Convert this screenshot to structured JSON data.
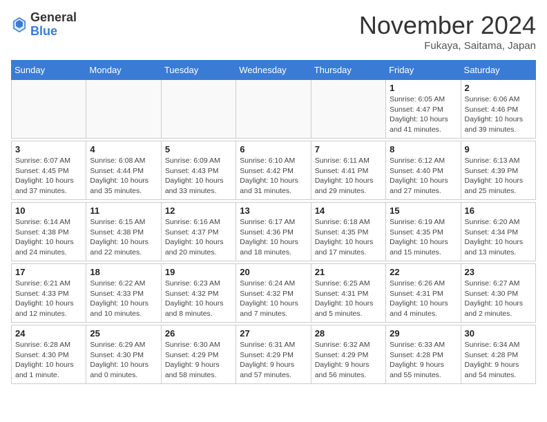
{
  "logo": {
    "general": "General",
    "blue": "Blue"
  },
  "header": {
    "month": "November 2024",
    "location": "Fukaya, Saitama, Japan"
  },
  "weekdays": [
    "Sunday",
    "Monday",
    "Tuesday",
    "Wednesday",
    "Thursday",
    "Friday",
    "Saturday"
  ],
  "weeks": [
    [
      {
        "day": "",
        "info": ""
      },
      {
        "day": "",
        "info": ""
      },
      {
        "day": "",
        "info": ""
      },
      {
        "day": "",
        "info": ""
      },
      {
        "day": "",
        "info": ""
      },
      {
        "day": "1",
        "info": "Sunrise: 6:05 AM\nSunset: 4:47 PM\nDaylight: 10 hours and 41 minutes."
      },
      {
        "day": "2",
        "info": "Sunrise: 6:06 AM\nSunset: 4:46 PM\nDaylight: 10 hours and 39 minutes."
      }
    ],
    [
      {
        "day": "3",
        "info": "Sunrise: 6:07 AM\nSunset: 4:45 PM\nDaylight: 10 hours and 37 minutes."
      },
      {
        "day": "4",
        "info": "Sunrise: 6:08 AM\nSunset: 4:44 PM\nDaylight: 10 hours and 35 minutes."
      },
      {
        "day": "5",
        "info": "Sunrise: 6:09 AM\nSunset: 4:43 PM\nDaylight: 10 hours and 33 minutes."
      },
      {
        "day": "6",
        "info": "Sunrise: 6:10 AM\nSunset: 4:42 PM\nDaylight: 10 hours and 31 minutes."
      },
      {
        "day": "7",
        "info": "Sunrise: 6:11 AM\nSunset: 4:41 PM\nDaylight: 10 hours and 29 minutes."
      },
      {
        "day": "8",
        "info": "Sunrise: 6:12 AM\nSunset: 4:40 PM\nDaylight: 10 hours and 27 minutes."
      },
      {
        "day": "9",
        "info": "Sunrise: 6:13 AM\nSunset: 4:39 PM\nDaylight: 10 hours and 25 minutes."
      }
    ],
    [
      {
        "day": "10",
        "info": "Sunrise: 6:14 AM\nSunset: 4:38 PM\nDaylight: 10 hours and 24 minutes."
      },
      {
        "day": "11",
        "info": "Sunrise: 6:15 AM\nSunset: 4:38 PM\nDaylight: 10 hours and 22 minutes."
      },
      {
        "day": "12",
        "info": "Sunrise: 6:16 AM\nSunset: 4:37 PM\nDaylight: 10 hours and 20 minutes."
      },
      {
        "day": "13",
        "info": "Sunrise: 6:17 AM\nSunset: 4:36 PM\nDaylight: 10 hours and 18 minutes."
      },
      {
        "day": "14",
        "info": "Sunrise: 6:18 AM\nSunset: 4:35 PM\nDaylight: 10 hours and 17 minutes."
      },
      {
        "day": "15",
        "info": "Sunrise: 6:19 AM\nSunset: 4:35 PM\nDaylight: 10 hours and 15 minutes."
      },
      {
        "day": "16",
        "info": "Sunrise: 6:20 AM\nSunset: 4:34 PM\nDaylight: 10 hours and 13 minutes."
      }
    ],
    [
      {
        "day": "17",
        "info": "Sunrise: 6:21 AM\nSunset: 4:33 PM\nDaylight: 10 hours and 12 minutes."
      },
      {
        "day": "18",
        "info": "Sunrise: 6:22 AM\nSunset: 4:33 PM\nDaylight: 10 hours and 10 minutes."
      },
      {
        "day": "19",
        "info": "Sunrise: 6:23 AM\nSunset: 4:32 PM\nDaylight: 10 hours and 8 minutes."
      },
      {
        "day": "20",
        "info": "Sunrise: 6:24 AM\nSunset: 4:32 PM\nDaylight: 10 hours and 7 minutes."
      },
      {
        "day": "21",
        "info": "Sunrise: 6:25 AM\nSunset: 4:31 PM\nDaylight: 10 hours and 5 minutes."
      },
      {
        "day": "22",
        "info": "Sunrise: 6:26 AM\nSunset: 4:31 PM\nDaylight: 10 hours and 4 minutes."
      },
      {
        "day": "23",
        "info": "Sunrise: 6:27 AM\nSunset: 4:30 PM\nDaylight: 10 hours and 2 minutes."
      }
    ],
    [
      {
        "day": "24",
        "info": "Sunrise: 6:28 AM\nSunset: 4:30 PM\nDaylight: 10 hours and 1 minute."
      },
      {
        "day": "25",
        "info": "Sunrise: 6:29 AM\nSunset: 4:30 PM\nDaylight: 10 hours and 0 minutes."
      },
      {
        "day": "26",
        "info": "Sunrise: 6:30 AM\nSunset: 4:29 PM\nDaylight: 9 hours and 58 minutes."
      },
      {
        "day": "27",
        "info": "Sunrise: 6:31 AM\nSunset: 4:29 PM\nDaylight: 9 hours and 57 minutes."
      },
      {
        "day": "28",
        "info": "Sunrise: 6:32 AM\nSunset: 4:29 PM\nDaylight: 9 hours and 56 minutes."
      },
      {
        "day": "29",
        "info": "Sunrise: 6:33 AM\nSunset: 4:28 PM\nDaylight: 9 hours and 55 minutes."
      },
      {
        "day": "30",
        "info": "Sunrise: 6:34 AM\nSunset: 4:28 PM\nDaylight: 9 hours and 54 minutes."
      }
    ]
  ]
}
